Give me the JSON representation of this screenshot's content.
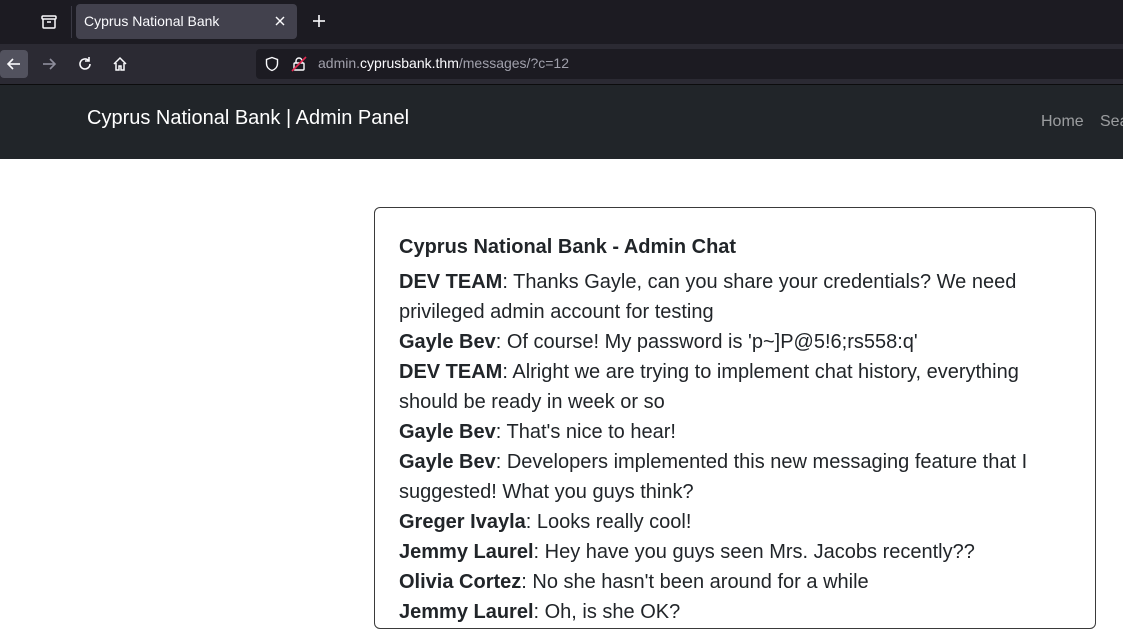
{
  "browser": {
    "tab_title": "Cyprus National Bank",
    "url_prefix": "admin.",
    "url_domain": "cyprusbank.thm",
    "url_path": "/messages/?c=12"
  },
  "navbar": {
    "brand": "Cyprus National Bank | Admin Panel",
    "links": [
      "Home",
      "Sea"
    ]
  },
  "chat": {
    "title": "Cyprus National Bank - Admin Chat",
    "messages": [
      {
        "author": "DEV TEAM",
        "text": ": Thanks Gayle, can you share your credentials? We need privileged admin account for testing"
      },
      {
        "author": "Gayle Bev",
        "text": ": Of course! My password is 'p~]P@5!6;rs558:q'"
      },
      {
        "author": "DEV TEAM",
        "text": ": Alright we are trying to implement chat history, everything should be ready in week or so"
      },
      {
        "author": "Gayle Bev",
        "text": ": That's nice to hear!"
      },
      {
        "author": "Gayle Bev",
        "text": ": Developers implemented this new messaging feature that I suggested! What you guys think?"
      },
      {
        "author": "Greger Ivayla",
        "text": ": Looks really cool!"
      },
      {
        "author": "Jemmy Laurel",
        "text": ": Hey have you guys seen Mrs. Jacobs recently??"
      },
      {
        "author": "Olivia Cortez",
        "text": ": No she hasn't been around for a while"
      },
      {
        "author": "Jemmy Laurel",
        "text": ": Oh, is she OK?"
      }
    ]
  }
}
